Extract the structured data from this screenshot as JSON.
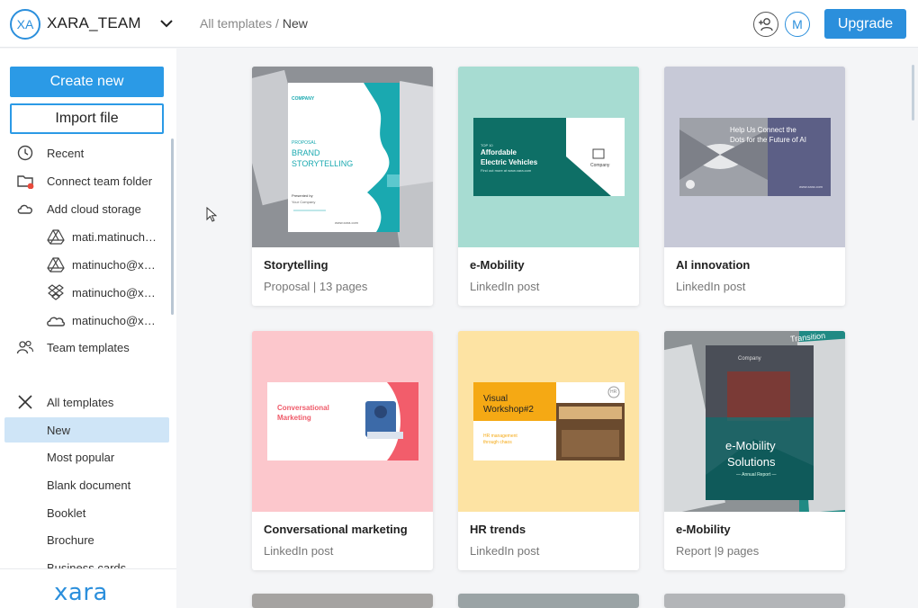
{
  "header": {
    "team_initials": "XA",
    "team_name": "XARA_TEAM",
    "breadcrumb_parent": "All templates",
    "breadcrumb_separator": " / ",
    "breadcrumb_current": "New",
    "user_initial": "M",
    "upgrade_label": "Upgrade"
  },
  "sidebar": {
    "create_label": "Create new",
    "import_label": "Import file",
    "nav": {
      "recent": "Recent",
      "connect_folder": "Connect team folder",
      "cloud": "Add cloud storage",
      "drive1": "mati.matinucho@gmail.com",
      "drive2": "matinucho@xara.com",
      "dropbox": "matinucho@xara.com",
      "onedrive": "matinucho@xara.com",
      "team_templates": "Team templates"
    },
    "categories": {
      "all": "All templates",
      "new": "New",
      "popular": "Most popular",
      "blank": "Blank document",
      "booklet": "Booklet",
      "brochure": "Brochure",
      "business": "Business cards"
    },
    "logo": "xara"
  },
  "cards": [
    {
      "title": "Storytelling",
      "subtitle": "Proposal | 13 pages",
      "thumb": {
        "company": "COMPANY",
        "kicker": "PROPOSAL",
        "line1": "BRAND",
        "line2": "STORYTELLING",
        "presented": "Presented by",
        "presenter": "Your Company",
        "url": "www.xara.com"
      }
    },
    {
      "title": "e-Mobility",
      "subtitle": "LinkedIn post",
      "thumb": {
        "kicker": "TOP 10",
        "line1": "Affordable",
        "line2": "Electric Vehicles",
        "small": "Find out more at www.xara.com",
        "company": "Company"
      }
    },
    {
      "title": "AI innovation",
      "subtitle": "LinkedIn post",
      "thumb": {
        "line1": "Help Us Connect the",
        "line2": "Dots for the Future of AI",
        "url": "www.xara.com"
      }
    },
    {
      "title": "Conversational marketing",
      "subtitle": "LinkedIn post",
      "thumb": {
        "line1": "Conversational",
        "line2": "Marketing"
      }
    },
    {
      "title": "HR trends",
      "subtitle": "LinkedIn post",
      "thumb": {
        "line1": "Visual",
        "line2": "Workshop#2",
        "small1": "HR management",
        "small2": "through chaos",
        "badge": "HR"
      }
    },
    {
      "title": "e-Mobility",
      "subtitle": "Report |9 pages",
      "thumb": {
        "company": "Company",
        "line1": "e-Mobility",
        "line2": "Solutions",
        "small": "— Annual Report —",
        "bg_text": "Transition"
      }
    }
  ],
  "colors": {
    "accent": "#2b8fdc",
    "button": "#2b9ae6",
    "selected_bg": "#cfe5f7"
  }
}
